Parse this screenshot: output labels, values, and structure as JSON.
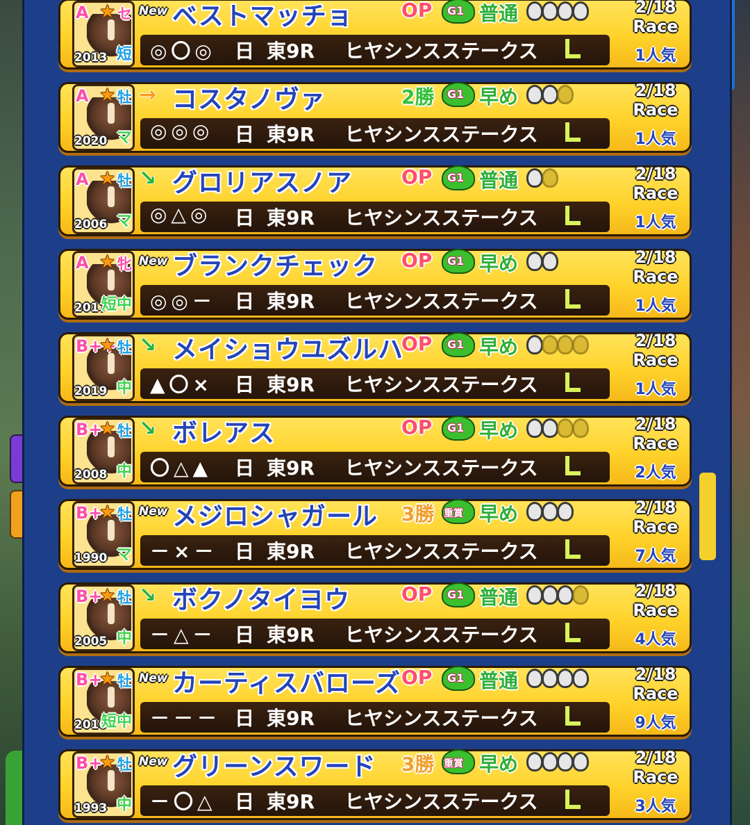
{
  "colors": {
    "panel": "#1d3f8a",
    "row_yellow": "#ffd22a",
    "name_blue": "#2444b8",
    "op_pink": "#ff4f6a",
    "pace_green": "#2fae3a",
    "scrollbar": "#f5d02c"
  },
  "horses": [
    {
      "rank": "A",
      "sex": "セ",
      "year": "2013",
      "aptitude": "短",
      "badge": "New",
      "name": "ベストマッチョ",
      "race_class": "OP",
      "grade": "G1",
      "pace": "普通",
      "shoes_total": 4,
      "shoes_on": 4,
      "marks": "◎〇◎",
      "day": "日",
      "venue": "東9R",
      "race_name": "ヒヤシンスステークス",
      "date": "2/18",
      "race": "Race",
      "popularity": "1人気"
    },
    {
      "rank": "A",
      "sex": "牡",
      "year": "2020",
      "aptitude": "マ",
      "badge": "→",
      "name": "コスタノヴァ",
      "race_class": "2勝",
      "grade": "G1",
      "pace": "早め",
      "shoes_total": 3,
      "shoes_on": 2,
      "marks": "◎◎◎",
      "day": "日",
      "venue": "東9R",
      "race_name": "ヒヤシンスステークス",
      "date": "2/18",
      "race": "Race",
      "popularity": "1人気"
    },
    {
      "rank": "A",
      "sex": "牡",
      "year": "2006",
      "aptitude": "マ",
      "badge": "↘",
      "name": "グロリアスノア",
      "race_class": "OP",
      "grade": "G1",
      "pace": "普通",
      "shoes_total": 2,
      "shoes_on": 1,
      "marks": "◎△◎",
      "day": "日",
      "venue": "東9R",
      "race_name": "ヒヤシンスステークス",
      "date": "2/18",
      "race": "Race",
      "popularity": "1人気"
    },
    {
      "rank": "A",
      "sex": "牝",
      "year": "2017",
      "aptitude": "短中",
      "badge": "New",
      "name": "ブランクチェック",
      "race_class": "OP",
      "grade": "G1",
      "pace": "早め",
      "shoes_total": 2,
      "shoes_on": 2,
      "marks": "◎◎－",
      "day": "日",
      "venue": "東9R",
      "race_name": "ヒヤシンスステークス",
      "date": "2/18",
      "race": "Race",
      "popularity": "1人気"
    },
    {
      "rank": "B++",
      "sex": "牡",
      "year": "2019",
      "aptitude": "中",
      "badge": "↘",
      "name": "メイショウユズルハ",
      "race_class": "OP",
      "grade": "G1",
      "pace": "早め",
      "shoes_total": 4,
      "shoes_on": 1,
      "marks": "▲〇×",
      "day": "日",
      "venue": "東9R",
      "race_name": "ヒヤシンスステークス",
      "date": "2/18",
      "race": "Race",
      "popularity": "1人気"
    },
    {
      "rank": "B+",
      "sex": "牡",
      "year": "2008",
      "aptitude": "中",
      "badge": "↘",
      "name": "ボレアス",
      "race_class": "OP",
      "grade": "G1",
      "pace": "早め",
      "shoes_total": 4,
      "shoes_on": 2,
      "marks": "〇△▲",
      "day": "日",
      "venue": "東9R",
      "race_name": "ヒヤシンスステークス",
      "date": "2/18",
      "race": "Race",
      "popularity": "2人気"
    },
    {
      "rank": "B+",
      "sex": "牡",
      "year": "1990",
      "aptitude": "マ",
      "badge": "New",
      "name": "メジロシャガール",
      "race_class": "3勝",
      "grade": "重賞",
      "pace": "早め",
      "shoes_total": 3,
      "shoes_on": 3,
      "marks": "－×－",
      "day": "日",
      "venue": "東9R",
      "race_name": "ヒヤシンスステークス",
      "date": "2/18",
      "race": "Race",
      "popularity": "7人気"
    },
    {
      "rank": "B+",
      "sex": "牡",
      "year": "2005",
      "aptitude": "中",
      "badge": "↘",
      "name": "ボクノタイヨウ",
      "race_class": "OP",
      "grade": "G1",
      "pace": "普通",
      "shoes_total": 4,
      "shoes_on": 3,
      "marks": "－△－",
      "day": "日",
      "venue": "東9R",
      "race_name": "ヒヤシンスステークス",
      "date": "2/18",
      "race": "Race",
      "popularity": "4人気"
    },
    {
      "rank": "B+",
      "sex": "牡",
      "year": "2010",
      "aptitude": "短中",
      "badge": "New",
      "name": "カーティスバローズ",
      "race_class": "OP",
      "grade": "G1",
      "pace": "普通",
      "shoes_total": 4,
      "shoes_on": 4,
      "marks": "－－－",
      "day": "日",
      "venue": "東9R",
      "race_name": "ヒヤシンスステークス",
      "date": "2/18",
      "race": "Race",
      "popularity": "9人気"
    },
    {
      "rank": "B+",
      "sex": "牡",
      "year": "1993",
      "aptitude": "中",
      "badge": "New",
      "name": "グリーンスワード",
      "race_class": "3勝",
      "grade": "重賞",
      "pace": "早め",
      "shoes_total": 4,
      "shoes_on": 4,
      "marks": "－〇△",
      "day": "日",
      "venue": "東9R",
      "race_name": "ヒヤシンスステークス",
      "date": "2/18",
      "race": "Race",
      "popularity": "3人気"
    }
  ]
}
